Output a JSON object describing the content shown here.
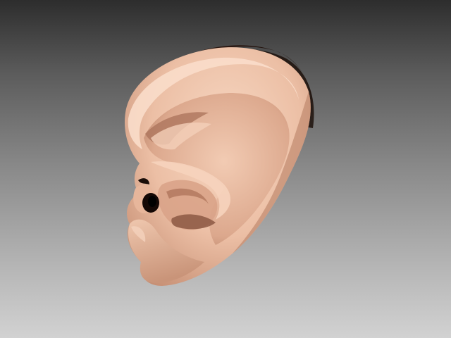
{
  "scene": {
    "subject": "ear-3d-model",
    "colors": {
      "background_top": "#2d2d2d",
      "background_bottom": "#d2d2d2",
      "skin_light": "#f6d4be",
      "skin_mid": "#e6b59b",
      "skin_shadow": "#b88066",
      "cavity": "#1a0d08"
    }
  }
}
